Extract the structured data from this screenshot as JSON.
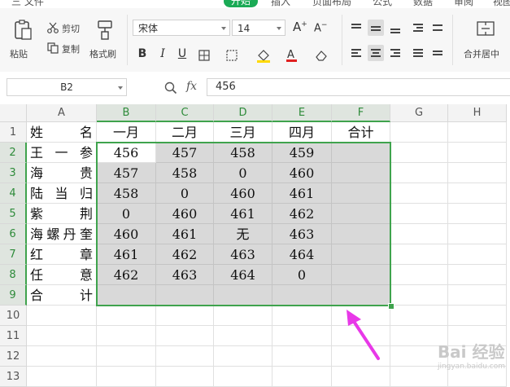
{
  "menu": {
    "items": [
      "三 文件",
      "插入",
      "页面布局",
      "公式",
      "数据",
      "审阅",
      "视图"
    ],
    "active_tab": "开始"
  },
  "ribbon": {
    "paste_label": "粘贴",
    "cut_label": "剪切",
    "copy_label": "复制",
    "format_painter_label": "格式刷",
    "font_name": "宋体",
    "font_size": "14",
    "merge_center_label": "合并居中"
  },
  "formula_bar": {
    "name_box": "B2",
    "fx_label": "fx",
    "value": "456"
  },
  "sheet": {
    "columns": [
      "A",
      "B",
      "C",
      "D",
      "E",
      "F",
      "G",
      "H"
    ],
    "rows": [
      "1",
      "2",
      "3",
      "4",
      "5",
      "6",
      "7",
      "8",
      "9",
      "10",
      "11",
      "12",
      "13"
    ],
    "header_row": [
      "一月",
      "二月",
      "三月",
      "四月",
      "合计"
    ],
    "names": [
      [
        "姓",
        "名"
      ],
      [
        "王",
        "一",
        "参"
      ],
      [
        "海",
        "贵"
      ],
      [
        "陆",
        "当",
        "归"
      ],
      [
        "紫",
        "荆"
      ],
      [
        "海",
        "螺",
        "丹",
        "奎"
      ],
      [
        "红",
        "章"
      ],
      [
        "任",
        "意"
      ],
      [
        "合",
        "计"
      ]
    ],
    "data": [
      [
        "456",
        "457",
        "458",
        "459",
        ""
      ],
      [
        "457",
        "458",
        "0",
        "460",
        ""
      ],
      [
        "458",
        "0",
        "460",
        "461",
        ""
      ],
      [
        "0",
        "460",
        "461",
        "462",
        ""
      ],
      [
        "460",
        "461",
        "无",
        "463",
        ""
      ],
      [
        "461",
        "462",
        "463",
        "464",
        ""
      ],
      [
        "462",
        "463",
        "464",
        "0",
        ""
      ],
      [
        "",
        "",
        "",
        "",
        ""
      ]
    ]
  },
  "accent_color": "#3fa34d",
  "annotation_arrow_color": "#e838e8",
  "watermark": {
    "text": "Bai 经验",
    "sub": "jingyan.baidu.com"
  }
}
